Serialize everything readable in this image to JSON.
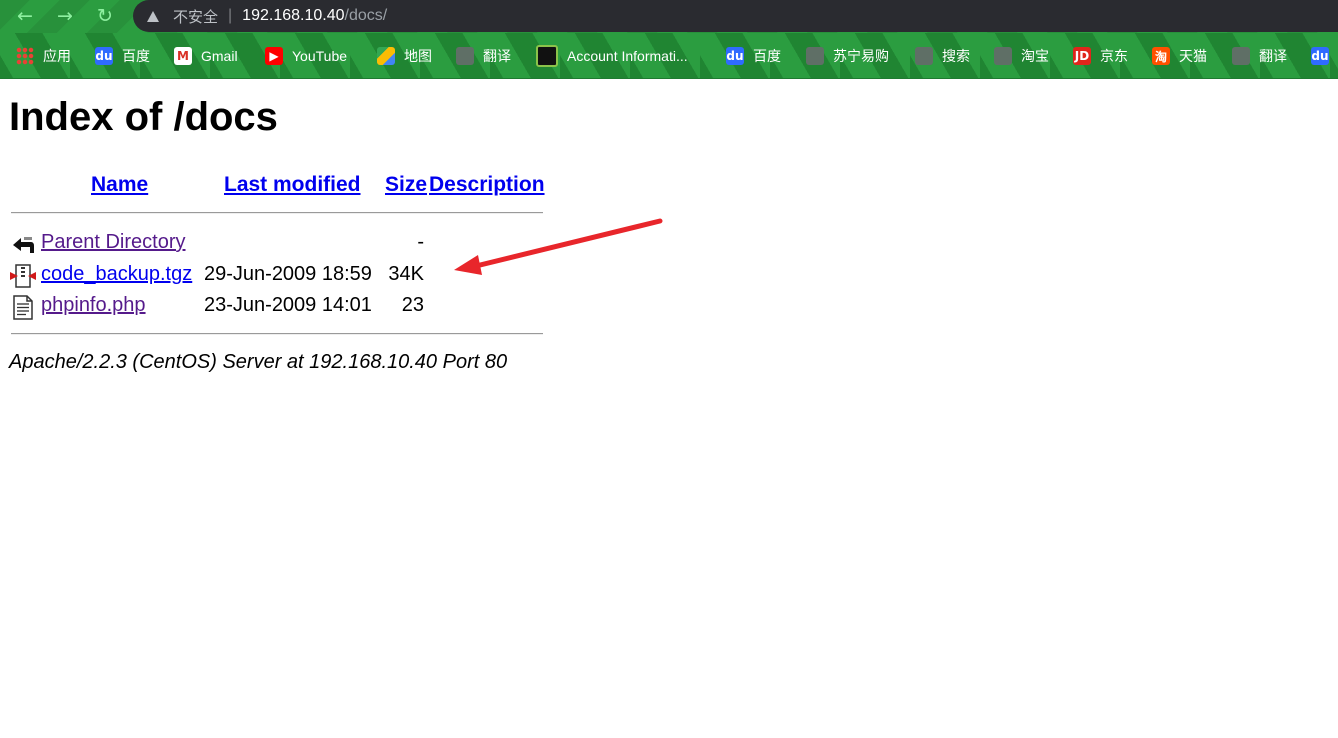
{
  "browser": {
    "security_label": "不安全",
    "url_host": "192.168.10.40",
    "url_path": "/docs/",
    "bookmarks": [
      {
        "label": "应用",
        "icon": "apps-grid-icon"
      },
      {
        "label": "百度",
        "icon": "baidu-icon"
      },
      {
        "label": "Gmail",
        "icon": "gmail-icon"
      },
      {
        "label": "YouTube",
        "icon": "youtube-icon"
      },
      {
        "label": "地图",
        "icon": "maps-icon"
      },
      {
        "label": "翻译",
        "icon": "globe-icon"
      },
      {
        "label": "Account Informati...",
        "icon": "account-icon"
      },
      {
        "label": "百度",
        "icon": "baidu-icon"
      },
      {
        "label": "苏宁易购",
        "icon": "globe-icon"
      },
      {
        "label": "搜索",
        "icon": "globe-icon"
      },
      {
        "label": "淘宝",
        "icon": "globe-icon"
      },
      {
        "label": "京东",
        "icon": "jd-icon"
      },
      {
        "label": "天猫",
        "icon": "tmall-icon"
      },
      {
        "label": "翻译",
        "icon": "globe-icon"
      }
    ]
  },
  "page": {
    "title": "Index of /docs",
    "columns": {
      "name": "Name",
      "last_modified": "Last modified",
      "size": "Size",
      "description": "Description"
    },
    "rows": [
      {
        "name": "Parent Directory",
        "modified": "",
        "size": "-",
        "icon": "back-folder-icon"
      },
      {
        "name": "code_backup.tgz",
        "modified": "29-Jun-2009 18:59",
        "size": "34K",
        "icon": "compressed-file-icon"
      },
      {
        "name": "phpinfo.php",
        "modified": "23-Jun-2009 14:01",
        "size": "23",
        "icon": "text-file-icon"
      }
    ],
    "footer": "Apache/2.2.3 (CentOS) Server at 192.168.10.40 Port 80"
  },
  "colors": {
    "annotation_arrow": "#e8262b",
    "link": "#0000ee",
    "visited_link": "#551a8b"
  }
}
